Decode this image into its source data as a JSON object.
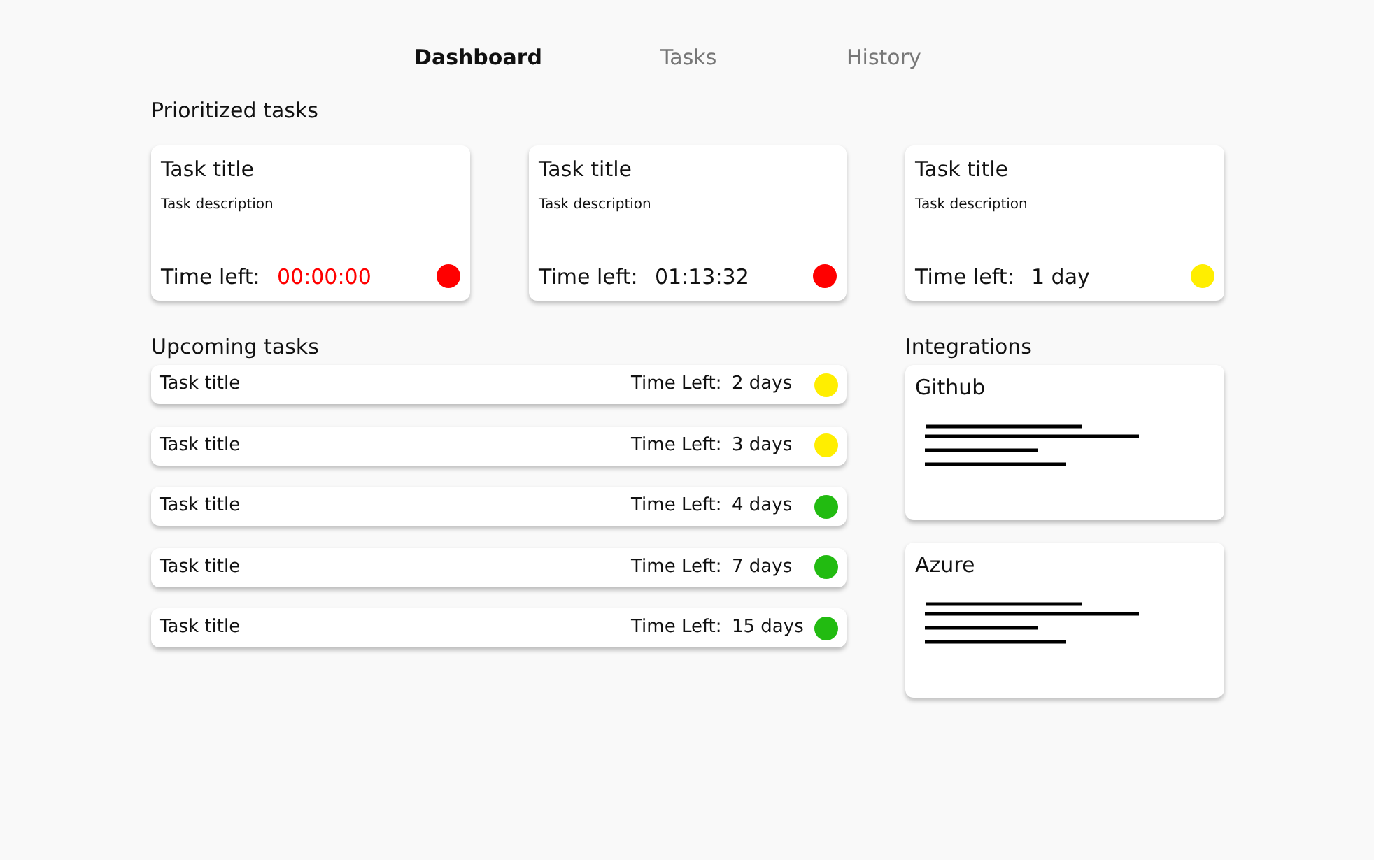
{
  "nav": [
    {
      "label": "Dashboard",
      "selected": true
    },
    {
      "label": "Tasks",
      "selected": false
    },
    {
      "label": "History",
      "selected": false
    }
  ],
  "prioritized": {
    "heading": "Prioritized tasks",
    "tasks": [
      {
        "title": "Task title",
        "description": "Task description",
        "time_label": "Time left:",
        "time": "00:00:00",
        "overdue": true,
        "color": "#ff0000"
      },
      {
        "title": "Task title",
        "description": "Task description",
        "time_label": "Time left:",
        "time": "01:13:32",
        "overdue": false,
        "color": "#ff0000"
      },
      {
        "title": "Task title",
        "description": "Task description",
        "time_label": "Time left:",
        "time": "1 day",
        "overdue": false,
        "color": "#ffee00"
      }
    ]
  },
  "upcoming": {
    "heading": "Upcoming tasks",
    "tasks": [
      {
        "title": "Task title",
        "time_label": "Time Left:",
        "time": "2 days",
        "color": "#ffee00"
      },
      {
        "title": "Task title",
        "time_label": "Time Left:",
        "time": "3 days",
        "color": "#ffee00"
      },
      {
        "title": "Task title",
        "time_label": "Time Left:",
        "time": "4 days",
        "color": "#22bb11"
      },
      {
        "title": "Task title",
        "time_label": "Time Left:",
        "time": "7 days",
        "color": "#22bb11"
      },
      {
        "title": "Task title",
        "time_label": "Time Left:",
        "time": "15 days",
        "color": "#22bb11"
      }
    ]
  },
  "integrations": {
    "heading": "Integrations",
    "items": [
      {
        "name": "Github"
      },
      {
        "name": "Azure"
      }
    ]
  }
}
